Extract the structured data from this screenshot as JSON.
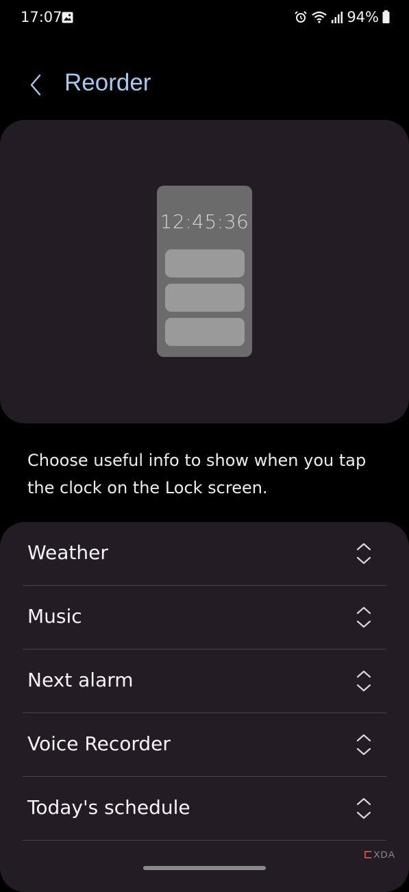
{
  "status_bar": {
    "time": "17:07",
    "battery": "94%",
    "icons": [
      "gallery-icon",
      "alarm-icon",
      "wifi-icon",
      "signal-icon",
      "battery-icon"
    ]
  },
  "header": {
    "title": "Reorder",
    "back_icon": "chevron-left-icon",
    "title_color": "#a7c8f0"
  },
  "preview": {
    "clock": "12:45:36"
  },
  "description": "Choose useful info to show when you tap the clock on the Lock screen.",
  "list": {
    "items": [
      {
        "label": "Weather",
        "icon": "reorder-handle-icon"
      },
      {
        "label": "Music",
        "icon": "reorder-handle-icon"
      },
      {
        "label": "Next alarm",
        "icon": "reorder-handle-icon"
      },
      {
        "label": "Voice Recorder",
        "icon": "reorder-handle-icon"
      },
      {
        "label": "Today's schedule",
        "icon": "reorder-handle-icon"
      }
    ]
  },
  "watermark": "XDA",
  "colors": {
    "background": "#000000",
    "card": "#221c25",
    "accent": "#a7c8f0"
  }
}
